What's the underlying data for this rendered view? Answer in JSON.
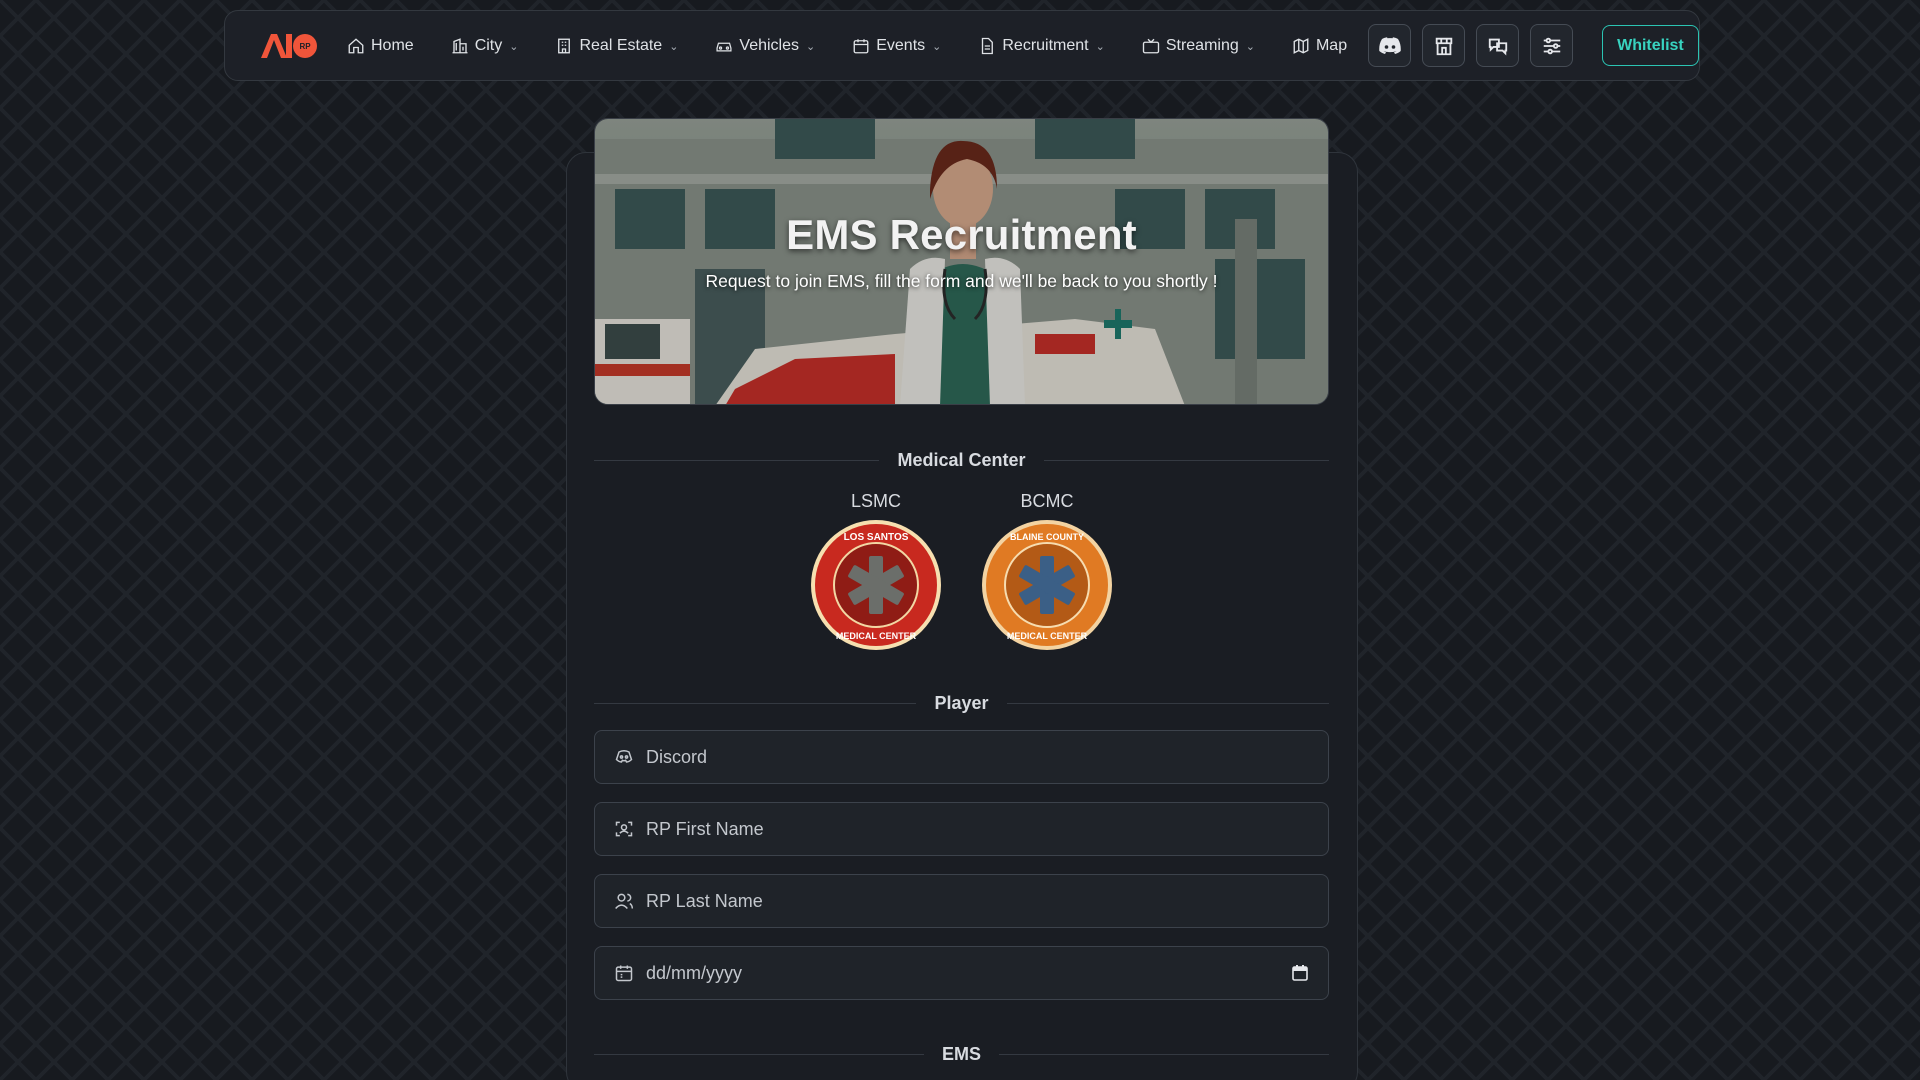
{
  "nav": {
    "logo_text": "AIO",
    "logo_badge": "RP",
    "items": [
      {
        "label": "Home",
        "icon": "home-icon",
        "dropdown": false
      },
      {
        "label": "City",
        "icon": "city-icon",
        "dropdown": true
      },
      {
        "label": "Real Estate",
        "icon": "building-icon",
        "dropdown": true
      },
      {
        "label": "Vehicles",
        "icon": "car-icon",
        "dropdown": true
      },
      {
        "label": "Events",
        "icon": "calendar-icon",
        "dropdown": true
      },
      {
        "label": "Recruitment",
        "icon": "document-icon",
        "dropdown": true
      },
      {
        "label": "Streaming",
        "icon": "tv-icon",
        "dropdown": true
      },
      {
        "label": "Map",
        "icon": "map-icon",
        "dropdown": false
      }
    ],
    "icon_buttons": [
      "discord-icon",
      "shop-icon",
      "chat-icon",
      "settings-sliders-icon"
    ],
    "whitelist_label": "Whitelist"
  },
  "hero": {
    "title": "EMS Recruitment",
    "subtitle": "Request to join EMS, fill the form and we'll be back to you shortly !"
  },
  "medical_center": {
    "heading": "Medical Center",
    "centers": [
      {
        "name": "LSMC",
        "badge_top": "LOS SANTOS",
        "badge_bottom": "MEDICAL CENTER",
        "color": "#c8291f"
      },
      {
        "name": "BCMC",
        "badge_top": "BLAINE COUNTY",
        "badge_bottom": "MEDICAL CENTER",
        "color": "#e07a23"
      }
    ]
  },
  "player": {
    "heading": "Player",
    "fields": {
      "discord_placeholder": "Discord",
      "first_name_placeholder": "RP First Name",
      "last_name_placeholder": "RP Last Name",
      "date_placeholder": "dd/mm/yyyy"
    }
  },
  "ems": {
    "heading": "EMS"
  },
  "colors": {
    "accent": "#2bc4b3",
    "logo": "#f0553a",
    "background": "#171a1f"
  }
}
